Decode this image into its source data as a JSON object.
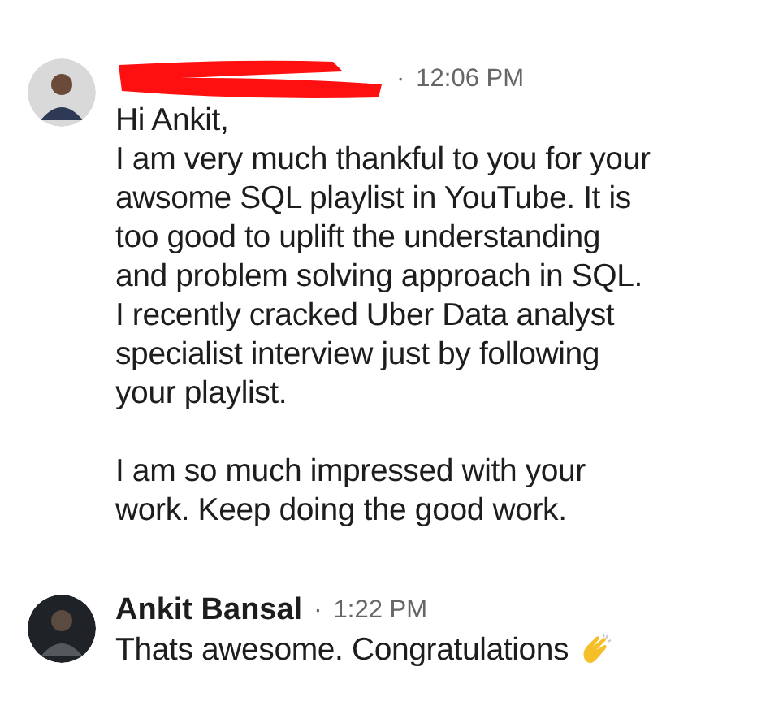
{
  "messages": [
    {
      "sender": {
        "redacted": true
      },
      "separator": "·",
      "time": "12:06 PM",
      "paragraphs": [
        [
          "Hi Ankit,",
          "I am very much thankful to you for your",
          "awsome SQL playlist in YouTube. It is",
          "too good to uplift the understanding",
          "and problem solving approach in SQL.",
          "I recently cracked Uber Data analyst",
          "specialist interview just by following",
          "your playlist."
        ],
        [
          "I am so much impressed with your",
          "work. Keep doing the good work."
        ]
      ]
    },
    {
      "sender": {
        "redacted": false,
        "name": "Ankit Bansal"
      },
      "separator": "·",
      "time": "1:22 PM",
      "paragraphs": [
        [
          "Thats awesome. Congratulations"
        ]
      ],
      "trailing_icon": true
    }
  ]
}
